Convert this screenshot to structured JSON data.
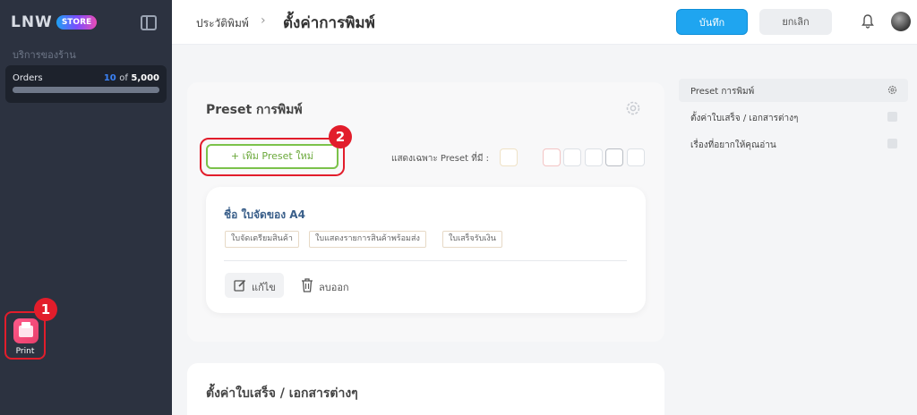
{
  "sidebar": {
    "logo_text": "LNW",
    "logo_badge": "STORE",
    "section_title": "บริการของร้าน",
    "orders": {
      "label": "Orders",
      "used": "10",
      "of": "of",
      "total": "5,000",
      "fraction": 0.002
    },
    "app": {
      "label": "Print",
      "icon": "print-app-icon"
    }
  },
  "header": {
    "breadcrumb": "ประวัติพิมพ์",
    "separator": "›",
    "title": "ตั้งค่าการพิมพ์",
    "save_label": "บันทึก",
    "cancel_label": "ยกเลิก",
    "icons": [
      "bell-icon",
      "avatar"
    ]
  },
  "preset_section": {
    "title": "Preset การพิมพ์",
    "add_button": "+ เพิ่ม Preset ใหม่",
    "filter_label": "แสดงเฉพาะ Preset ที่มี :",
    "preset": {
      "name": "ชื่อ ใบจัดของ A4",
      "tags": [
        "ใบจัดเตรียมสินค้า",
        "ใบแสดงรายการสินค้าพร้อมส่ง",
        "ใบเสร็จรับเงิน"
      ],
      "edit_label": "แก้ไข",
      "delete_label": "ลบออก"
    }
  },
  "second_section": {
    "title": "ตั้งค่าใบเสร็จ / เอกสารต่างๆ"
  },
  "right_nav": [
    {
      "label": "Preset การพิมพ์",
      "icon": "gear-icon"
    },
    {
      "label": "ตั้งค่าใบเสร็จ / เอกสารต่างๆ",
      "icon": "doc-icon"
    },
    {
      "label": "เรื่องที่อยากให้คุณอ่าน",
      "icon": "doc-icon"
    }
  ],
  "annotations": {
    "badge_1": "1",
    "badge_2": "2"
  },
  "colors": {
    "primary": "#1fa5f0",
    "success": "#7bc24a",
    "highlight": "#e21d2b",
    "sidebar": "#2c3240"
  }
}
